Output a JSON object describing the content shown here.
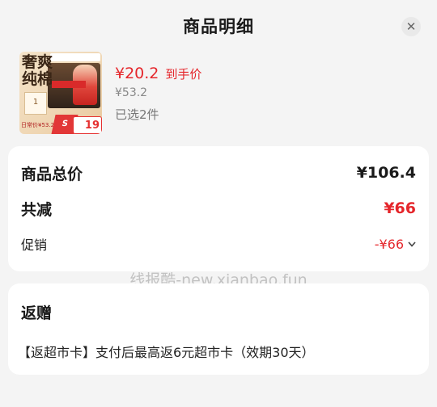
{
  "header": {
    "title": "商品明细",
    "close_icon": "close-icon"
  },
  "product": {
    "thumbnail": {
      "big_text": "奢爽\n纯棉",
      "card_number": "1",
      "daily_price_text": "日常价¥53.2",
      "sticker_number": "19"
    },
    "price": "¥20.2",
    "price_tag": "到手价",
    "original_price": "¥53.2",
    "selected_count": "已选2件"
  },
  "summary": {
    "total_label": "商品总价",
    "total_value": "¥106.4",
    "discount_label": "共减",
    "discount_value": "¥66",
    "promo_label": "促销",
    "promo_value": "-¥66",
    "promo_icon": "chevron-down-icon"
  },
  "gift": {
    "title": "返赠",
    "description": "【返超市卡】支付后最高返6元超市卡（效期30天）"
  },
  "watermark": "线报酷-new.xianbao.fun",
  "colors": {
    "accent_red": "#e5262b",
    "background": "#f4f4f4",
    "card": "#ffffff"
  }
}
